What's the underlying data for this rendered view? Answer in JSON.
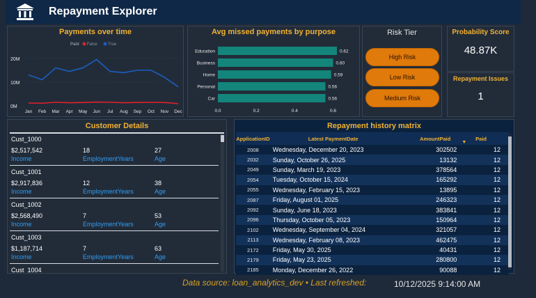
{
  "header": {
    "title": "Repayment Explorer",
    "icon": "bank-icon"
  },
  "payments_over_time": {
    "title": "Payments over time",
    "legend_title": "Paid",
    "legend": [
      {
        "name": "False",
        "color": "#e0202a"
      },
      {
        "name": "True",
        "color": "#1a5fbf"
      }
    ]
  },
  "avg_missed": {
    "title": "Avg missed payments by purpose"
  },
  "risk_tier": {
    "title": "Risk Tier",
    "options": [
      "High Risk",
      "Low Risk",
      "Medium Risk"
    ]
  },
  "probability": {
    "title": "Probability Score",
    "value": "48.87K"
  },
  "issues": {
    "title": "Repayment Issues",
    "value": "1"
  },
  "customer_details": {
    "title": "Customer Details",
    "labels": {
      "income": "Income",
      "employment": "EmploymentYears",
      "age": "Age"
    },
    "records": [
      {
        "id": "Cust_1000",
        "income": "$2,517,542",
        "employment": "18",
        "age": "27"
      },
      {
        "id": "Cust_1001",
        "income": "$2,917,836",
        "employment": "12",
        "age": "38"
      },
      {
        "id": "Cust_1002",
        "income": "$2,568,490",
        "employment": "7",
        "age": "53"
      },
      {
        "id": "Cust_1003",
        "income": "$1,187,714",
        "employment": "7",
        "age": "63"
      },
      {
        "id": "Cust_1004",
        "income": "",
        "employment": "",
        "age": ""
      }
    ]
  },
  "matrix": {
    "title": "Repayment history matrix",
    "columns": [
      "ApplicationID",
      "Latest PaymentDate",
      "AmountPaid",
      "Paid"
    ],
    "rows": [
      [
        "2008",
        "Wednesday, December 20, 2023",
        "302502",
        "12"
      ],
      [
        "2032",
        "Sunday, October 26, 2025",
        "13132",
        "12"
      ],
      [
        "2049",
        "Sunday, March 19, 2023",
        "378564",
        "12"
      ],
      [
        "2054",
        "Tuesday, October 15, 2024",
        "165292",
        "12"
      ],
      [
        "2055",
        "Wednesday, February 15, 2023",
        "13895",
        "12"
      ],
      [
        "2087",
        "Friday, August 01, 2025",
        "246323",
        "12"
      ],
      [
        "2092",
        "Sunday, June 18, 2023",
        "383841",
        "12"
      ],
      [
        "2096",
        "Thursday, October 05, 2023",
        "150964",
        "12"
      ],
      [
        "2102",
        "Wednesday, September 04, 2024",
        "321057",
        "12"
      ],
      [
        "2113",
        "Wednesday, February 08, 2023",
        "462475",
        "12"
      ],
      [
        "2172",
        "Friday, May 30, 2025",
        "40431",
        "12"
      ],
      [
        "2179",
        "Friday, May 23, 2025",
        "280800",
        "12"
      ],
      [
        "2185",
        "Monday, December 26, 2022",
        "90088",
        "12"
      ]
    ]
  },
  "footer": {
    "source": "Data source: loan_analytics_dev • Last refreshed:",
    "timestamp": "10/12/2025 9:14:00 AM"
  },
  "chart_data": [
    {
      "type": "line",
      "title": "Payments over time",
      "x": [
        "Jan",
        "Feb",
        "Mar",
        "Apr",
        "May",
        "Jun",
        "Jul",
        "Aug",
        "Sep",
        "Oct",
        "Nov",
        "Dec"
      ],
      "yticks": [
        "0M",
        "10M",
        "20M"
      ],
      "ylim": [
        0,
        22000000
      ],
      "legend_title": "Paid",
      "series": [
        {
          "name": "False",
          "color": "#e0202a",
          "values": [
            1200000,
            1100000,
            1500000,
            1300000,
            1400000,
            1600000,
            1500000,
            1300000,
            1400000,
            1500000,
            1400000,
            900000
          ]
        },
        {
          "name": "True",
          "color": "#1a5fbf",
          "values": [
            13000000,
            11000000,
            16000000,
            14500000,
            16000000,
            19500000,
            14500000,
            14000000,
            15000000,
            15000000,
            12000000,
            8000000
          ]
        }
      ]
    },
    {
      "type": "bar",
      "orientation": "horizontal",
      "title": "Avg missed payments by purpose",
      "categories": [
        "Education",
        "Business",
        "Home",
        "Personal",
        "Car"
      ],
      "values": [
        0.62,
        0.6,
        0.59,
        0.56,
        0.56
      ],
      "labels": [
        "0.62",
        "0.60",
        "0.59",
        "0.56",
        "0.56"
      ],
      "xticks": [
        "0.0",
        "0.2",
        "0.4",
        "0.6"
      ],
      "xlim": [
        0,
        0.62
      ],
      "color": "#14857a"
    }
  ]
}
